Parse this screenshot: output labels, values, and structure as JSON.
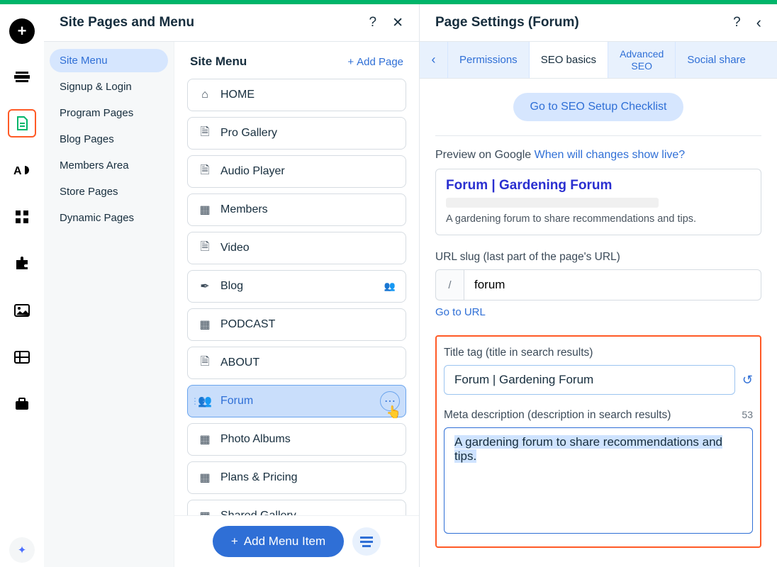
{
  "leftPanel": {
    "title": "Site Pages and Menu",
    "help": "?",
    "close": "✕"
  },
  "categories": [
    {
      "label": "Site Menu",
      "active": true
    },
    {
      "label": "Signup & Login"
    },
    {
      "label": "Program Pages"
    },
    {
      "label": "Blog Pages"
    },
    {
      "label": "Members Area"
    },
    {
      "label": "Store Pages"
    },
    {
      "label": "Dynamic Pages"
    }
  ],
  "pagesCol": {
    "heading": "Site Menu",
    "addPage": "Add Page"
  },
  "pages": [
    {
      "icon": "home",
      "label": "HOME"
    },
    {
      "icon": "doc",
      "label": "Pro Gallery"
    },
    {
      "icon": "doc",
      "label": "Audio Player"
    },
    {
      "icon": "grid",
      "label": "Members"
    },
    {
      "icon": "doc",
      "label": "Video"
    },
    {
      "icon": "pen",
      "label": "Blog",
      "aux": "group"
    },
    {
      "icon": "grid",
      "label": "PODCAST"
    },
    {
      "icon": "doc",
      "label": "ABOUT"
    },
    {
      "icon": "forum",
      "label": "Forum",
      "selected": true
    },
    {
      "icon": "grid",
      "label": "Photo Albums"
    },
    {
      "icon": "grid",
      "label": "Plans & Pricing"
    },
    {
      "icon": "grid",
      "label": "Shared Gallery"
    }
  ],
  "footer": {
    "addMenuItem": "Add Menu Item"
  },
  "rightPanel": {
    "title": "Page Settings (Forum)",
    "help": "?",
    "back": "‹"
  },
  "tabs": {
    "arrow": "‹",
    "items": [
      {
        "label": "Permissions"
      },
      {
        "label": "SEO basics",
        "active": true
      },
      {
        "label1": "Advanced",
        "label2": "SEO",
        "multi": true
      },
      {
        "label": "Social share"
      }
    ]
  },
  "seo": {
    "checklistBtn": "Go to SEO Setup Checklist",
    "previewLabel": "Preview on Google ",
    "previewLink": "When will changes show live?",
    "gpTitle": "Forum | Gardening Forum",
    "gpDesc": "A gardening forum to share recommendations and tips.",
    "urlSlugLabel": "URL slug (last part of the page's URL)",
    "slash": "/",
    "urlSlugValue": "forum",
    "goToUrl": "Go to URL",
    "titleTagLabel": "Title tag (title in search results)",
    "titleTagValue": "Forum | Gardening Forum",
    "metaLabel": "Meta description (description in search results)",
    "metaCount": "53",
    "metaValue": "A gardening forum to share recommendations and tips."
  }
}
